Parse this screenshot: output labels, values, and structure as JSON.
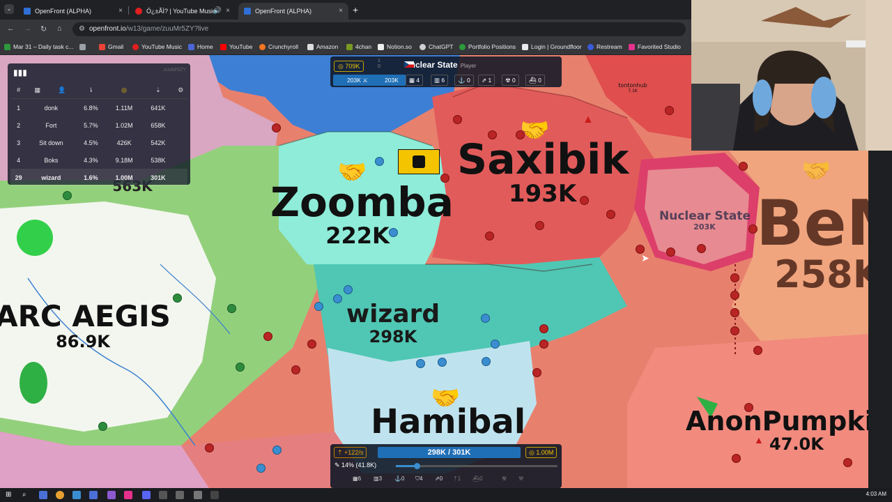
{
  "browser": {
    "tabs": [
      {
        "label": "OpenFront (ALPHA)",
        "close": "×",
        "active": false
      },
      {
        "label": "Ó¿±ÃÌ? | YouTube Music",
        "close": "×",
        "active": false
      },
      {
        "label": "OpenFront (ALPHA)",
        "close": "×",
        "active": true
      }
    ],
    "new_tab": "+",
    "url_host": "openfront.io",
    "url_path": "/w13/game/zuuMr5ZY?live",
    "bookmarks": [
      "Mar 31 – Daily task c...",
      "Gmail",
      "YouTube Music",
      "Home",
      "YouTube",
      "Crunchyroll",
      "Amazon",
      "4chan",
      "Notion.so",
      "ChatGPT",
      "Portfolio Positions",
      "Login | Groundfloor",
      "Restream",
      "Favorited Studio"
    ]
  },
  "leaderboard": {
    "game_id": "zuuMr5ZY",
    "headers": [
      "#",
      "",
      "",
      "",
      "",
      "",
      ""
    ],
    "rows": [
      {
        "rank": "1",
        "name": "donk",
        "land": "6.8%",
        "gold": "1.11M",
        "troops": "641K"
      },
      {
        "rank": "2",
        "name": "Fort",
        "land": "5.7%",
        "gold": "1.02M",
        "troops": "658K"
      },
      {
        "rank": "3",
        "name": "Sit down",
        "land": "4.5%",
        "gold": "426K",
        "troops": "542K"
      },
      {
        "rank": "4",
        "name": "Boks",
        "land": "4.3%",
        "gold": "9.18M",
        "troops": "538K"
      },
      {
        "rank": "29",
        "name": "wizard",
        "land": "1.6%",
        "gold": "1.00M",
        "troops": "301K"
      }
    ]
  },
  "player_info": {
    "gold": "709K",
    "alliances_top": "1",
    "alliances_bottom": "0",
    "name": "Nuclear State",
    "type": "Player",
    "troops": "203K",
    "workers": "203K",
    "stats": [
      "4",
      "6",
      "0",
      "1",
      "0",
      "0"
    ]
  },
  "map": {
    "territories": [
      {
        "name": "Zoomba",
        "troops": "222K"
      },
      {
        "name": "Saxibik",
        "troops": "193K"
      },
      {
        "name": "BeM",
        "troops": "258K"
      },
      {
        "name": "ARC AEGIS",
        "troops": "86.9K"
      },
      {
        "name": "wizard",
        "troops": "298K"
      },
      {
        "name": "Hamibal",
        "troops": ""
      },
      {
        "name": "AnonPumpkin",
        "troops": "47.0K"
      },
      {
        "name": "Nuclear State",
        "troops": "203K"
      },
      {
        "name": "tontonhub",
        "troops": "7.1K"
      },
      {
        "name": "",
        "troops": "563K"
      }
    ]
  },
  "control": {
    "rate": "+122/s",
    "troops": "298K / 301K",
    "gold": "1.00M",
    "attack_ratio": "14% (41.8K)",
    "attack_ratio_value": 0.14,
    "buildings": [
      "6",
      "3",
      "0",
      "4",
      "0",
      "1",
      "0",
      "",
      ""
    ]
  },
  "taskbar": {
    "clock": "4:03 AM"
  }
}
